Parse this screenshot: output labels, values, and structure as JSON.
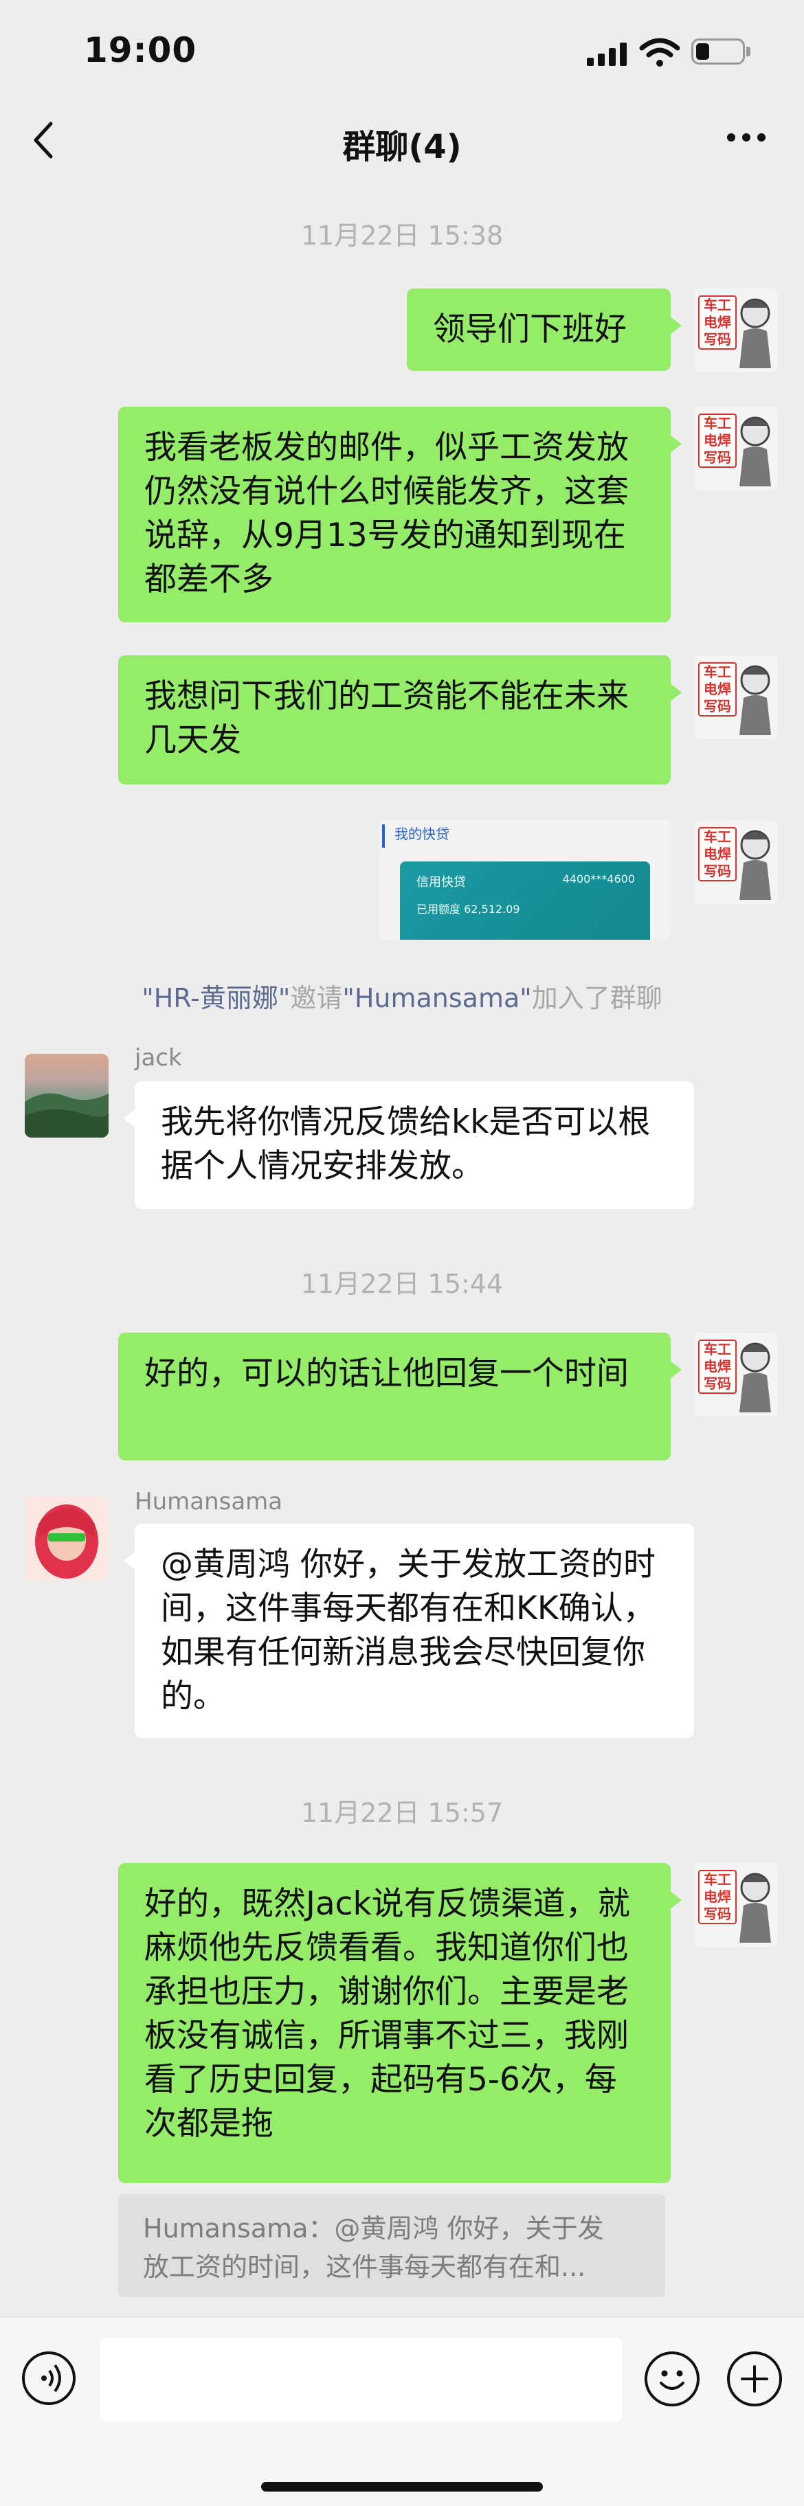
{
  "status_bar": {
    "time": "19:00",
    "battery_level": 0.3
  },
  "nav": {
    "title": "群聊(4)"
  },
  "messages": {
    "ts1": "11月22日 15:38",
    "m1": "领导们下班好",
    "m2": "我看老板发的邮件，似乎工资发放仍然没有说什么时候能发齐，这套说辞，从9月13号发的通知到现在都差不多",
    "m3": "我想问下我们的工资能不能在未来几天发",
    "img": {
      "title": "我的快贷",
      "label": "信用快贷",
      "card_no": "4400***4600",
      "limit": "已用额度  62,512.09"
    },
    "system": {
      "inviter": "\"HR-黄丽娜\"",
      "verb": "邀请",
      "invitee": "\"Humansama\"",
      "suffix": "加入了群聊"
    },
    "jack_name": "jack",
    "m4": "我先将你情况反馈给kk是否可以根据个人情况安排发放。",
    "ts2": "11月22日 15:44",
    "m5": "好的，可以的话让他回复一个时间",
    "human_name": "Humansama",
    "m6": "@黄周鸿 你好，关于发放工资的时间，这件事每天都有在和KK确认，如果有任何新消息我会尽快回复你的。",
    "ts3": "11月22日 15:57",
    "m7": "好的，既然Jack说有反馈渠道，就麻烦他先反馈看看。我知道你们也承担也压力，谢谢你们。主要是老板没有诚信，所谓事不过三，我刚看了历史回复，起码有5-6次，每次都是拖",
    "quote_line1": "Humansama：@黄周鸿 你好，关于发",
    "quote_line2": "放工资的时间，这件事每天都有在和..."
  },
  "avatar_stamp": "车工\n电焊\n写码",
  "input": {
    "value": ""
  },
  "icons": {
    "back": "chevron-left-icon",
    "more": "more-dots-icon",
    "voice": "voice-icon",
    "emoji": "emoji-icon",
    "plus": "plus-icon"
  }
}
